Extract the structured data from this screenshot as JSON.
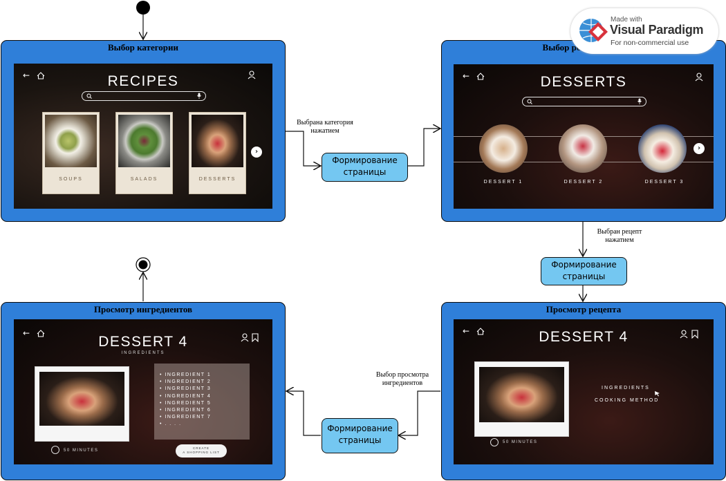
{
  "states": {
    "category": {
      "title": "Выбор категории",
      "screen_title": "RECIPES",
      "cards": [
        {
          "label": "SOUPS"
        },
        {
          "label": "SALADS"
        },
        {
          "label": "DESSERTS"
        }
      ],
      "next_icon": "›"
    },
    "recipe_select": {
      "title": "Выбор рецепта",
      "screen_title": "DESSERTS",
      "items": [
        {
          "label": "DESSERT 1"
        },
        {
          "label": "DESSERT 2"
        },
        {
          "label": "DESSERT 3"
        }
      ],
      "next_icon": "›"
    },
    "recipe_view": {
      "title": "Просмотр рецепта",
      "screen_title": "DESSERT 4",
      "menu": [
        "INGREDIENTS",
        "COOKING METHOD"
      ],
      "time": "50 MINUTES"
    },
    "ingredients_view": {
      "title": "Просмотр ингредиентов",
      "screen_title": "DESSERT 4",
      "subtitle": "INGREDIENTS",
      "ingredients": [
        "• INGREDIENT 1",
        "• INGREDIENT 2",
        "• INGREDIENT 3",
        "• INGREDIENT 4",
        "• INGREDIENT 5",
        "• INGREDIENT 6",
        "• INGREDIENT 7",
        "• . . . ."
      ],
      "time": "50 MINUTES",
      "button_line1": "CREATE",
      "button_line2": "A SHOPPING LIST"
    }
  },
  "actions": [
    {
      "line1": "Формирование",
      "line2": "страницы"
    },
    {
      "line1": "Формирование",
      "line2": "страницы"
    },
    {
      "line1": "Формирование",
      "line2": "страницы"
    }
  ],
  "transitions": [
    {
      "line1": "Выбрана категория",
      "line2": "нажатием"
    },
    {
      "line1": "Выбран рецепт",
      "line2": "нажатием"
    },
    {
      "line1": "Выбор просмотра",
      "line2": "ингредиентов"
    }
  ],
  "watermark": {
    "line1": "Made with",
    "brand": "Visual Paradigm",
    "line3": "For non-commercial use"
  },
  "colors": {
    "state_fill": "#2f7fd9",
    "action_fill": "#74c7f1",
    "line": "#111111"
  },
  "icons": [
    "back-arrow-icon",
    "home-icon",
    "user-icon",
    "search-icon",
    "microphone-icon",
    "bookmark-icon",
    "clock-icon",
    "chevron-right-icon",
    "cursor-icon"
  ]
}
